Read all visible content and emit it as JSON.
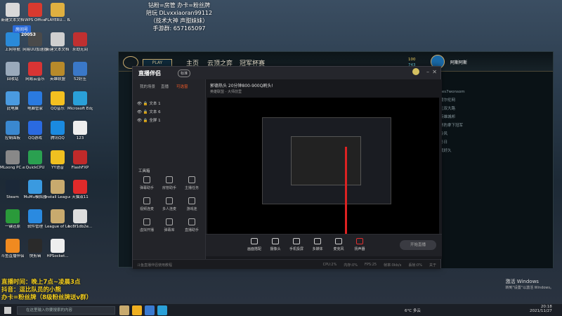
{
  "desktop": {
    "icons": [
      {
        "label": "新建文本文档",
        "color": "#d9d9d9"
      },
      {
        "label": "WPS Office",
        "color": "#d93a2f"
      },
      {
        "label": "PLAYERU... BATTLEGR...",
        "color": "#e0b040"
      },
      {
        "label": "上网导航",
        "color": "#2a8ad8"
      },
      {
        "label": "网易UU加速器",
        "color": "#4a4a4a"
      },
      {
        "label": "新建文本文档",
        "color": "#cfcfcf"
      },
      {
        "label": "永劫无间",
        "color": "#c03030"
      },
      {
        "label": "回收站",
        "color": "#9aaabb"
      },
      {
        "label": "网易云音乐",
        "color": "#d83434"
      },
      {
        "label": "英雄联盟",
        "color": "#b88a2a"
      },
      {
        "label": "52好压",
        "color": "#3a78c8"
      },
      {
        "label": "此电脑",
        "color": "#4a9ae0"
      },
      {
        "label": "电脑管家",
        "color": "#2a7ae0"
      },
      {
        "label": "QQ音乐",
        "color": "#f3c020"
      },
      {
        "label": "Microsoft Edge",
        "color": "#2aa0d8"
      },
      {
        "label": "控制面板",
        "color": "#3a88d0"
      },
      {
        "label": "QQ游戏",
        "color": "#2a6ae0"
      },
      {
        "label": "腾讯QQ",
        "color": "#1a8ae0"
      },
      {
        "label": "123",
        "color": "#eeeeee"
      },
      {
        "label": "MLoong PC.exe",
        "color": "#888888"
      },
      {
        "label": "QuickCPU",
        "color": "#2aa050"
      },
      {
        "label": "YY语音",
        "color": "#f0c020"
      },
      {
        "label": "FlashFXP",
        "color": "#c02a2a"
      },
      {
        "label": "Steam",
        "color": "#1b2838"
      },
      {
        "label": "MuMu模拟器",
        "color": "#3a9ae0"
      },
      {
        "label": "Install League ...",
        "color": "#c8aa6e"
      },
      {
        "label": "天猫双11",
        "color": "#e02a2a"
      },
      {
        "label": "一键还原",
        "color": "#2a9a3a"
      },
      {
        "label": "软件管理",
        "color": "#2a8ae0"
      },
      {
        "label": "League of Legends",
        "color": "#c8aa6e"
      },
      {
        "label": "bc8f1db2e...",
        "color": "#dddddd"
      },
      {
        "label": "斗鱼直播伴侣",
        "color": "#f08a20"
      },
      {
        "label": "快剪辑",
        "color": "#2a2a2a"
      },
      {
        "label": "HPSocket...",
        "color": "#eeeeee"
      }
    ]
  },
  "overlay": {
    "top_lines": [
      "钻粉=房管 办卡=粉丝牌",
      "陪玩 DLvxxiaoran99112",
      "（技术大神 声甜妹妹）",
      "手游群: 657165097"
    ],
    "left_tag": "房间号",
    "left_num": "20053",
    "bottom_lines": [
      "直播时间：晚上7点~凌晨3点",
      "抖音：逗比队员的小熊",
      "办卡=粉丝牌（8级粉丝牌送v群）"
    ]
  },
  "lol": {
    "play": "PLAY",
    "nav": [
      "主页",
      "云顶之弈",
      "冠军杯赛"
    ],
    "currency_1": "100",
    "currency_2": "743",
    "username": "阿斯阿斯",
    "chat_lines": [
      "ses7wonsom",
      "渡尔伦网",
      "无双大路",
      "英雄城邦",
      "黑豹拿下冠军",
      "冷风",
      "冬日",
      "我好久"
    ]
  },
  "zb": {
    "title": "直播伴侣",
    "version": "标准",
    "stream_title": "郭德热头 20分钟800-900Q刷头!",
    "category": "英雄联盟 - 大师前里",
    "tabs": [
      "我的场景",
      "直播",
      "可选窗"
    ],
    "layers": [
      "文本 1",
      "文本 6",
      "全屏 1"
    ],
    "tool_header": "工具箱",
    "tools": [
      "弹幕助手",
      "房管助手",
      "主播任务",
      "视频连麦",
      "多人连麦",
      "游戏连",
      "虚拟开播",
      "弹幕库",
      "直播助手"
    ],
    "bottom_buttons": [
      "画面搭配",
      "摄像头",
      "手机投屏",
      "多媒体",
      "麦克风",
      "扬声器"
    ],
    "start_button": "开始直播",
    "status": "斗鱼直播伴侣使用教程",
    "status_right": [
      "CPU:2%",
      "内存:0%",
      "FPS:25",
      "帧率:0kb/s",
      "丢帧:0%",
      "关于"
    ]
  },
  "taskbar": {
    "search_placeholder": "在这里输入你要搜索的内容",
    "weather": "6°C 多云",
    "time": "20:18",
    "date": "2021/11/27"
  },
  "activation": {
    "line1": "激活 Windows",
    "line2": "转到\"设置\"以激活 Windows。"
  }
}
